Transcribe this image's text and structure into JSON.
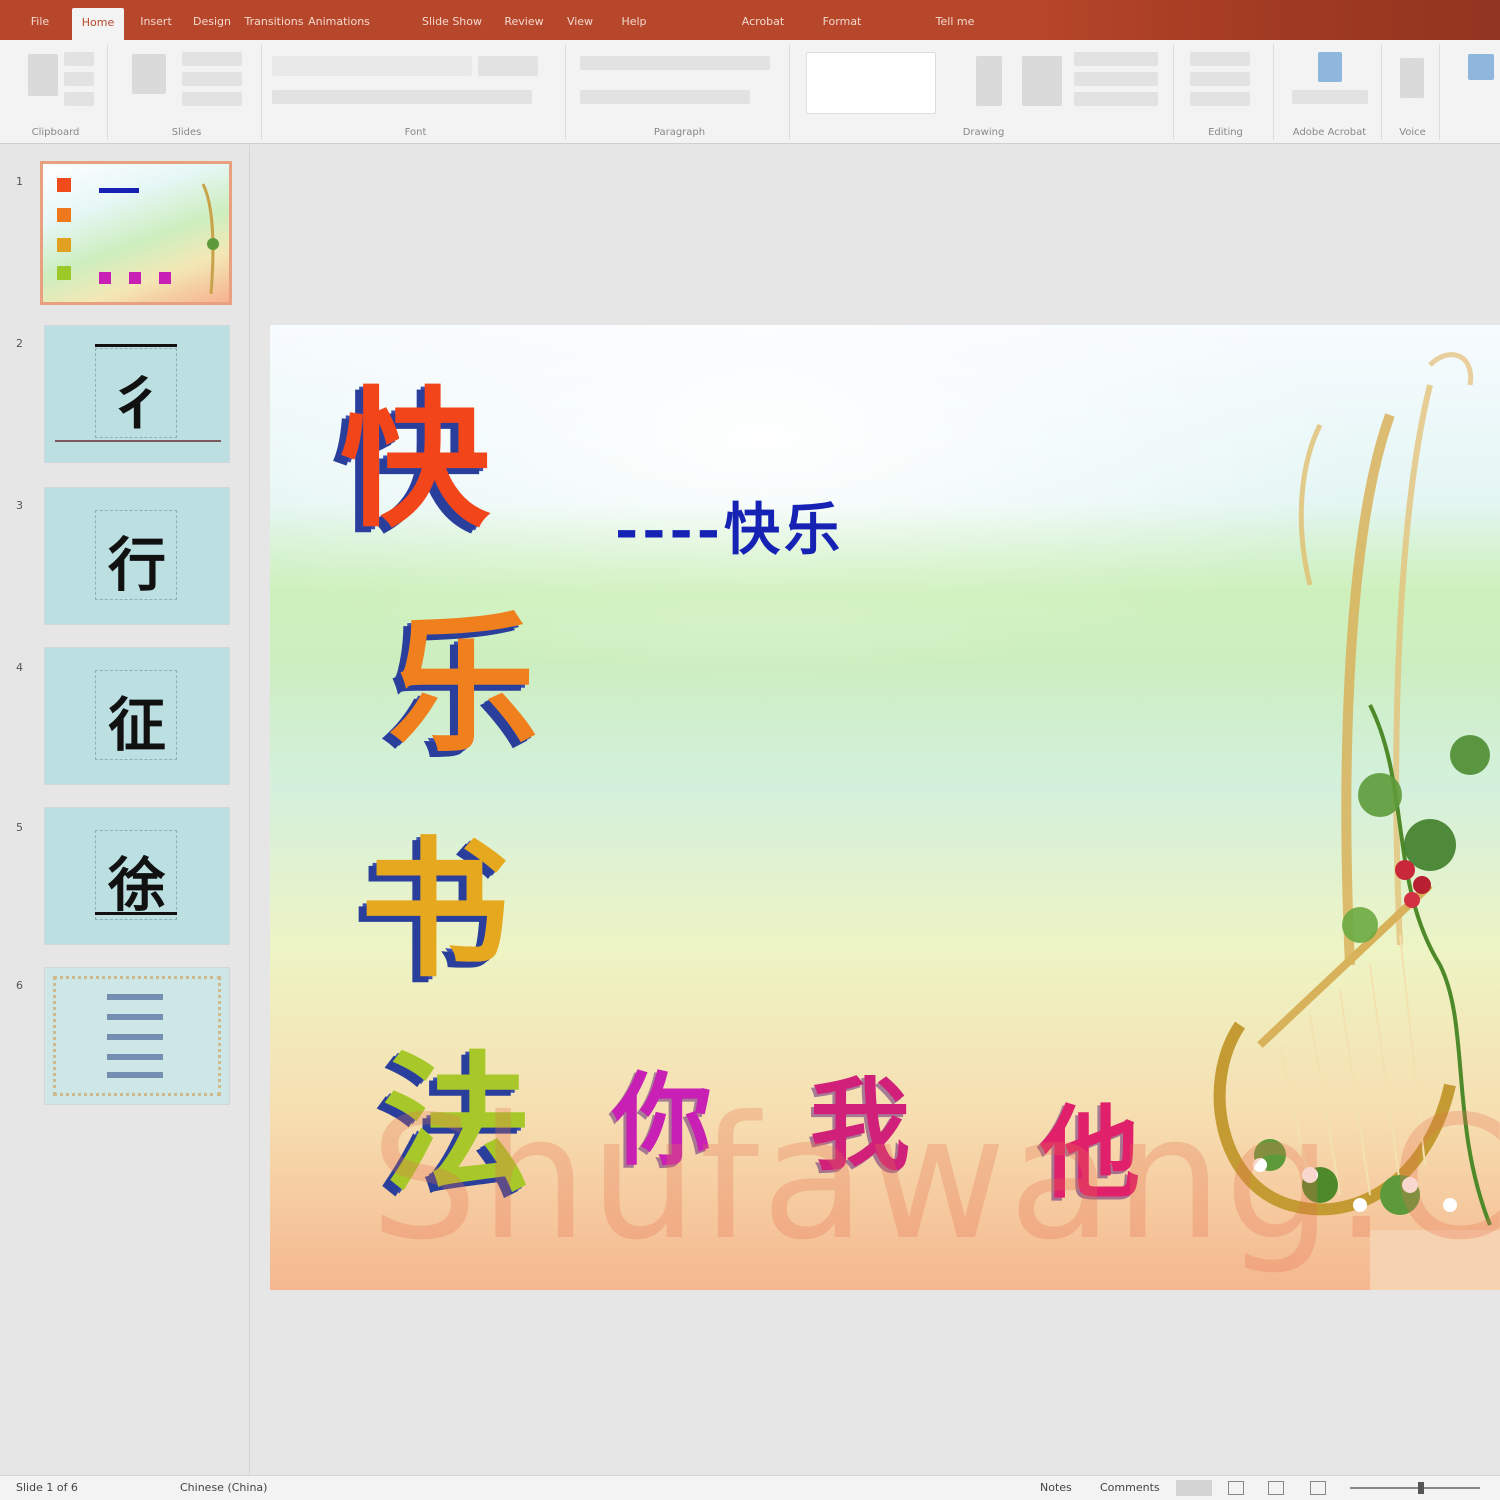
{
  "ribbon": {
    "tabs": [
      "File",
      "Home",
      "Insert",
      "Design",
      "Transitions",
      "Animations",
      "Slide Show",
      "Review",
      "View",
      "Help",
      "Acrobat",
      "Format",
      "Tell me"
    ],
    "active_tab": "Home",
    "groups": [
      "Clipboard",
      "Slides",
      "Font",
      "Paragraph",
      "Drawing",
      "Editing",
      "Adobe Acrobat",
      "Voice"
    ]
  },
  "thumbnails": [
    {
      "number": "1",
      "kind": "title",
      "char": ""
    },
    {
      "number": "2",
      "kind": "character",
      "char": "彳"
    },
    {
      "number": "3",
      "kind": "character",
      "char": "行"
    },
    {
      "number": "4",
      "kind": "character",
      "char": "征"
    },
    {
      "number": "5",
      "kind": "character",
      "char": "徐"
    },
    {
      "number": "6",
      "kind": "list",
      "char": ""
    }
  ],
  "slide": {
    "vertical_title": [
      "快",
      "乐",
      "书",
      "法"
    ],
    "subtitle": "----快乐",
    "pronouns": [
      "你",
      "我",
      "他"
    ],
    "watermark": "Shufawang.CN"
  },
  "status": {
    "slide_info": "Slide 1 of 6",
    "language": "Chinese (China)",
    "notes_label": "Notes",
    "comments_label": "Comments"
  },
  "colors": {
    "accent": "#b7472a",
    "subtitle_blue": "#1522b4",
    "pronoun_magenta": "#c81fb4"
  }
}
